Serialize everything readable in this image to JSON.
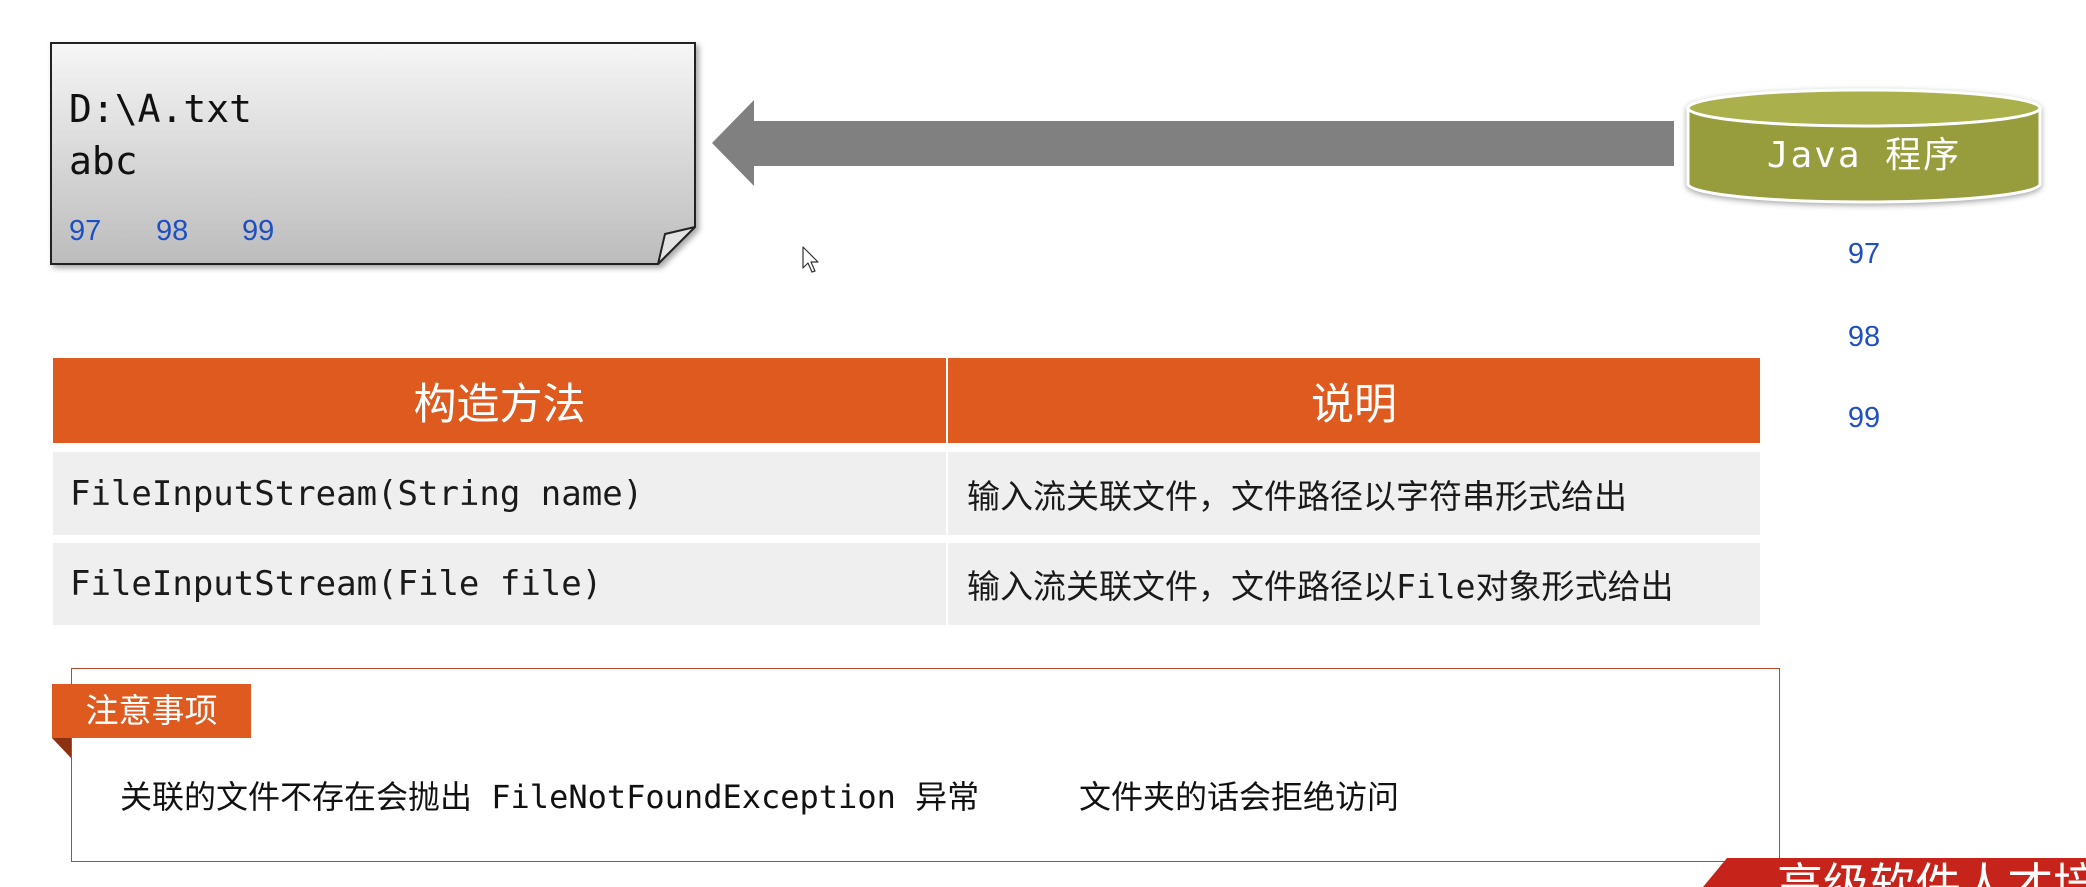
{
  "file_box": {
    "path": "D:\\A.txt",
    "content": "abc",
    "bytes": [
      "97",
      "98",
      "99"
    ]
  },
  "program": {
    "label": "Java 程序"
  },
  "read_values": [
    "97",
    "98",
    "99"
  ],
  "cursor": {
    "icon": "mouse-pointer-icon"
  },
  "table": {
    "headers": [
      "构造方法",
      "说明"
    ],
    "rows": [
      [
        "FileInputStream(String name)",
        "输入流关联文件，文件路径以字符串形式给出"
      ],
      [
        "FileInputStream(File file)",
        "输入流关联文件，文件路径以File对象形式给出"
      ]
    ]
  },
  "note": {
    "title": "注意事项",
    "text1": "关联的文件不存在会抛出 FileNotFoundException 异常",
    "text2": "文件夹的话会拒绝访问"
  },
  "banner": {
    "text": "高级软件人才培训"
  },
  "colors": {
    "accent": "#de5a1f",
    "accent_dark": "#8c3212",
    "program": "#979c3c",
    "program_top": "#aab04c",
    "arrow": "#808080",
    "byte_text": "#1f4fc2",
    "note_border": "#b4492c",
    "row_bg": "#efefef",
    "banner": "#c6241b"
  }
}
